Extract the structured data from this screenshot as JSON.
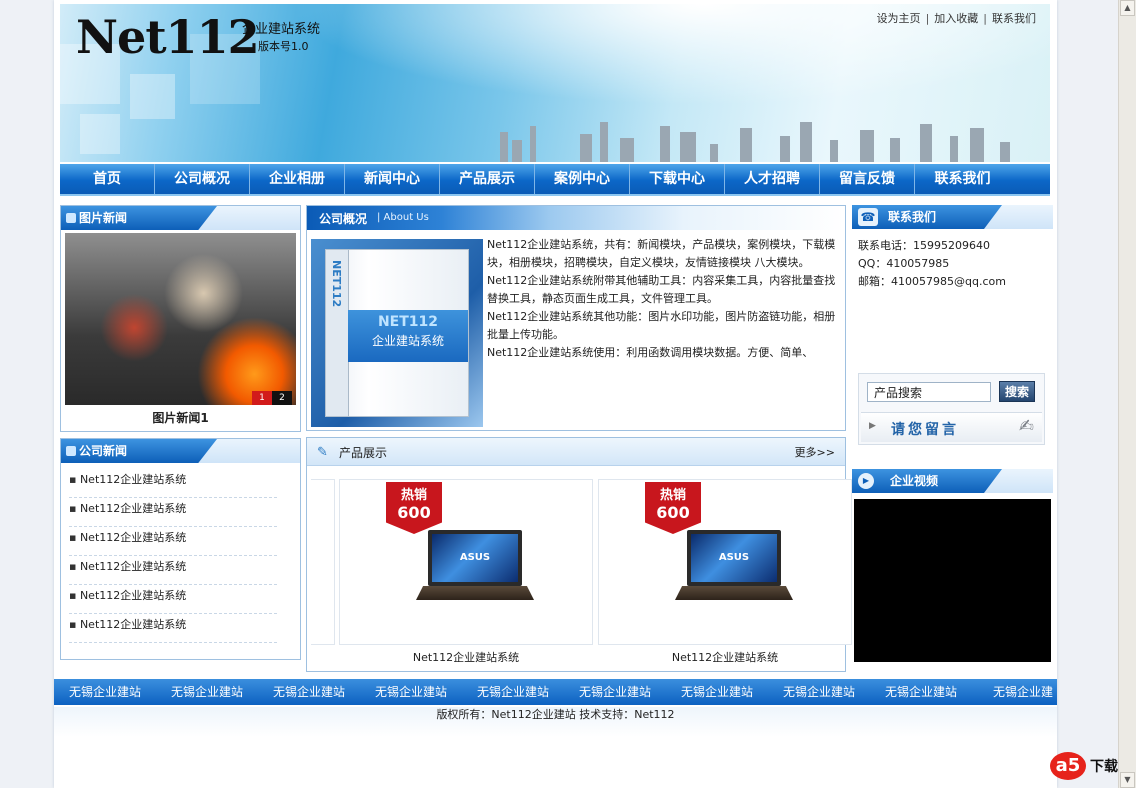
{
  "header": {
    "logo": "Net112",
    "tagline": "企业建站系统",
    "version": "版本号1.0",
    "links": [
      "设为主页",
      "加入收藏",
      "联系我们"
    ]
  },
  "nav": [
    "首页",
    "公司概况",
    "企业相册",
    "新闻中心",
    "产品展示",
    "案例中心",
    "下载中心",
    "人才招聘",
    "留言反馈",
    "联系我们"
  ],
  "picnews": {
    "title": "图片新闻",
    "caption": "图片新闻1",
    "pager": [
      "1",
      "2"
    ]
  },
  "compnews": {
    "title": "公司新闻",
    "items": [
      "Net112企业建站系统",
      "Net112企业建站系统",
      "Net112企业建站系统",
      "Net112企业建站系统",
      "Net112企业建站系统",
      "Net112企业建站系统"
    ]
  },
  "about": {
    "title": "公司概况",
    "subtitle": "| About Us",
    "box_spine": "NET112",
    "box_brand": "NET112",
    "box_name": "企业建站系统",
    "paragraphs": [
      "Net112企业建站系统，共有：新闻模块，产品模块，案例模块，下载模块，相册模块，招聘模块，自定义模块，友情链接模块 八大模块。",
      "Net112企业建站系统附带其他辅助工具：内容采集工具，内容批量查找替换工具，静态页面生成工具，文件管理工具。",
      "Net112企业建站系统其他功能：图片水印功能，图片防盗链功能，相册批量上传功能。",
      "Net112企业建站系统使用：利用函数调用模块数据。方便、简单、"
    ]
  },
  "products": {
    "title": "产品展示",
    "more": "更多>>",
    "items": [
      {
        "badge_top": "热销",
        "badge_num": "600",
        "brand": "ASUS",
        "caption": "Net112企业建站系统"
      },
      {
        "badge_top": "热销",
        "badge_num": "600",
        "brand": "ASUS",
        "caption": "Net112企业建站系统"
      }
    ]
  },
  "contact": {
    "title": "联系我们",
    "phone": "联系电话：15995209640",
    "qq": "QQ：410057985",
    "email": "邮箱：410057985@qq.com",
    "search_value": "产品搜索",
    "search_button": "搜索",
    "message_button": "请您留言"
  },
  "video": {
    "title": "企业视频"
  },
  "footer": {
    "marquee": [
      "无锡企业建站",
      "无锡企业建站",
      "无锡企业建站",
      "无锡企业建站",
      "无锡企业建站",
      "无锡企业建站",
      "无锡企业建站",
      "无锡企业建站",
      "无锡企业建站",
      "无锡企业建"
    ],
    "copyright": "版权所有：Net112企业建站 技术支持：Net112"
  },
  "watermark": {
    "logo": "a5",
    "text": "下载"
  },
  "colors": {
    "nav_blue": "#0c67c8",
    "accent_red": "#c8161d",
    "border_blue": "#9ec0e0"
  }
}
